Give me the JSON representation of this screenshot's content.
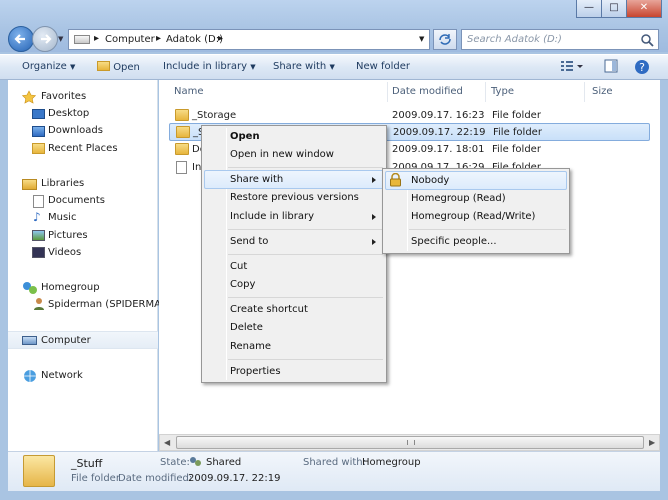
{
  "window": {
    "minimize_glyph": "—",
    "maximize_glyph": "□",
    "close_glyph": "✕"
  },
  "address": {
    "segments": [
      "Computer",
      "Adatok (D:)"
    ],
    "separator": "▸"
  },
  "search": {
    "placeholder": "Search Adatok (D:)"
  },
  "toolbar": {
    "organize": "Organize",
    "open": "Open",
    "include": "Include in library",
    "share": "Share with",
    "new_folder": "New folder"
  },
  "sidebar": {
    "favorites": "Favorites",
    "desktop": "Desktop",
    "downloads": "Downloads",
    "recent": "Recent Places",
    "libraries": "Libraries",
    "documents": "Documents",
    "music": "Music",
    "pictures": "Pictures",
    "videos": "Videos",
    "homegroup": "Homegroup",
    "homegroup_user": "Spiderman (SPIDERMAC",
    "computer": "Computer",
    "network": "Network"
  },
  "columns": {
    "name": "Name",
    "date": "Date modified",
    "type": "Type",
    "size": "Size"
  },
  "files": [
    {
      "name": "_Storage",
      "date": "2009.09.17. 16:23",
      "type": "File folder"
    },
    {
      "name": "_S",
      "date": "2009.09.17. 22:19",
      "type": "File folder"
    },
    {
      "name": "Do",
      "date": "2009.09.17. 18:01",
      "type": "File folder"
    },
    {
      "name": "In",
      "date": "2009.09.17. 16:29",
      "type": "File folder"
    }
  ],
  "context_menu": {
    "open": "Open",
    "open_new": "Open in new window",
    "share": "Share with",
    "restore": "Restore previous versions",
    "include": "Include in library",
    "send": "Send to",
    "cut": "Cut",
    "copy": "Copy",
    "shortcut": "Create shortcut",
    "delete": "Delete",
    "rename": "Rename",
    "properties": "Properties"
  },
  "share_menu": {
    "nobody": "Nobody",
    "hg_read": "Homegroup (Read)",
    "hg_rw": "Homegroup (Read/Write)",
    "specific": "Specific people..."
  },
  "details": {
    "name": "_Stuff",
    "type": "File folder",
    "date_label": "Date modified:",
    "date": "2009.09.17. 22:19",
    "state_label": "State:",
    "state": "Shared",
    "shared_label": "Shared with:",
    "shared": "Homegroup"
  }
}
